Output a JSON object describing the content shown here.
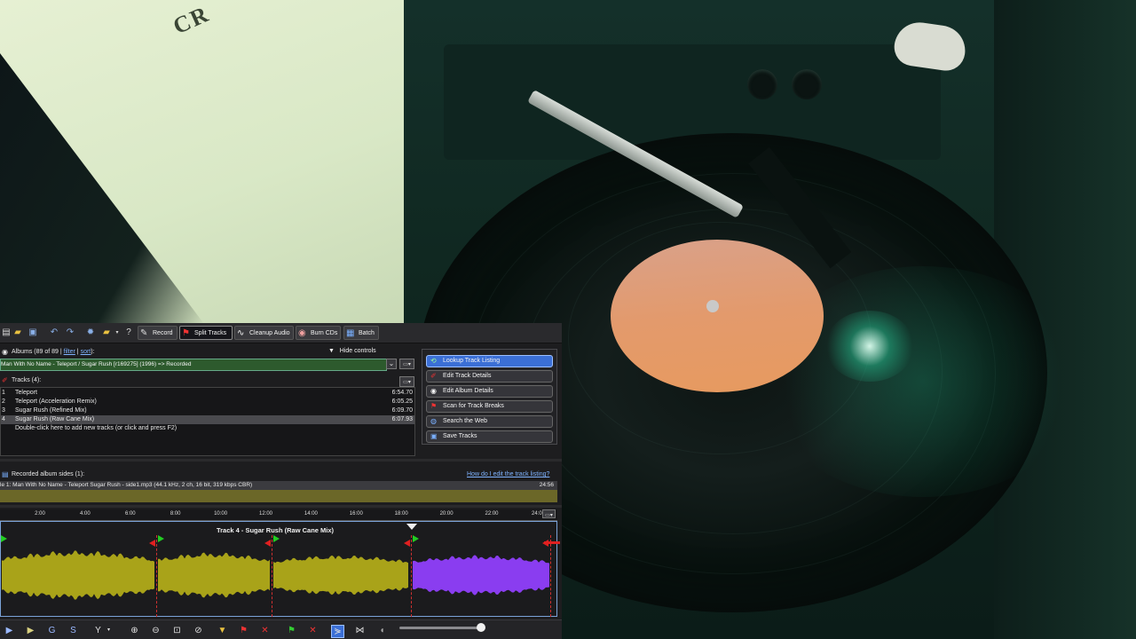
{
  "sleeve": {
    "text": "CR"
  },
  "toolbar": {
    "tabs": [
      {
        "label": "Record",
        "icon": "microphone-icon"
      },
      {
        "label": "Split Tracks",
        "icon": "split-flag-icon"
      },
      {
        "label": "Cleanup Audio",
        "icon": "waveform-icon"
      },
      {
        "label": "Burn CDs",
        "icon": "disc-icon"
      },
      {
        "label": "Batch",
        "icon": "batch-icon"
      }
    ],
    "active_tab": "Split Tracks"
  },
  "albums": {
    "label": "Albums (89 of 89 | ",
    "filter": "filter",
    "sep": " | ",
    "sort": "sort",
    "end": "):",
    "selected": "Man With No Name - Teleport / Sugar Rush [r169275] (1996) => Recorded",
    "hide_controls": "Hide controls"
  },
  "tracks": {
    "label": "Tracks (4):",
    "items": [
      {
        "num": "1",
        "title": "Teleport",
        "duration": "6:54.70"
      },
      {
        "num": "2",
        "title": "Teleport (Acceleration Remix)",
        "duration": "6:05.25"
      },
      {
        "num": "3",
        "title": "Sugar Rush (Refined Mix)",
        "duration": "6:09.70"
      },
      {
        "num": "4",
        "title": "Sugar Rush (Raw Cane Mix)",
        "duration": "6:07.93"
      }
    ],
    "add_hint": "Double-click here to add new tracks (or click and press F2)"
  },
  "actions": [
    {
      "label": "Lookup Track Listing",
      "icon": "lookup-icon"
    },
    {
      "label": "Edit Track Details",
      "icon": "edit-icon"
    },
    {
      "label": "Edit Album Details",
      "icon": "album-icon"
    },
    {
      "label": "Scan for Track Breaks",
      "icon": "scan-icon"
    },
    {
      "label": "Search the Web",
      "icon": "globe-icon"
    },
    {
      "label": "Save Tracks",
      "icon": "save-icon"
    }
  ],
  "recorded": {
    "label": "Recorded album sides (1):",
    "help_link": "How do I edit the track listing?",
    "row": "le 1: Man With No Name - Teleport   Sugar Rush - side1.mp3 (44.1 kHz, 2 ch, 16 bit, 319 kbps CBR)",
    "duration": "24:56"
  },
  "waveform": {
    "track_title": "Track 4 - Sugar Rush (Raw Cane Mix)",
    "ticks": [
      "2:00",
      "4:00",
      "6:00",
      "8:00",
      "10:00",
      "12:00",
      "14:00",
      "16:00",
      "18:00",
      "20:00",
      "22:00",
      "24:0"
    ],
    "colors": {
      "track": "#a9a319",
      "selected": "#8a3df0",
      "break": "#d03030",
      "flag": "#22cc22"
    }
  },
  "bottombar": {
    "icons": [
      "play-icon",
      "play-alt-icon",
      "g-icon",
      "s-icon",
      "filter-icon",
      "zoom-in-icon",
      "zoom-out-icon",
      "zoom-fit-icon",
      "zoom-selection-icon",
      "marker-down-icon",
      "add-break-icon",
      "remove-break-icon",
      "flag-pair-icon",
      "cross-icon",
      "snap-icon",
      "split-icon",
      "volume-icon"
    ],
    "volume": 0.92
  }
}
